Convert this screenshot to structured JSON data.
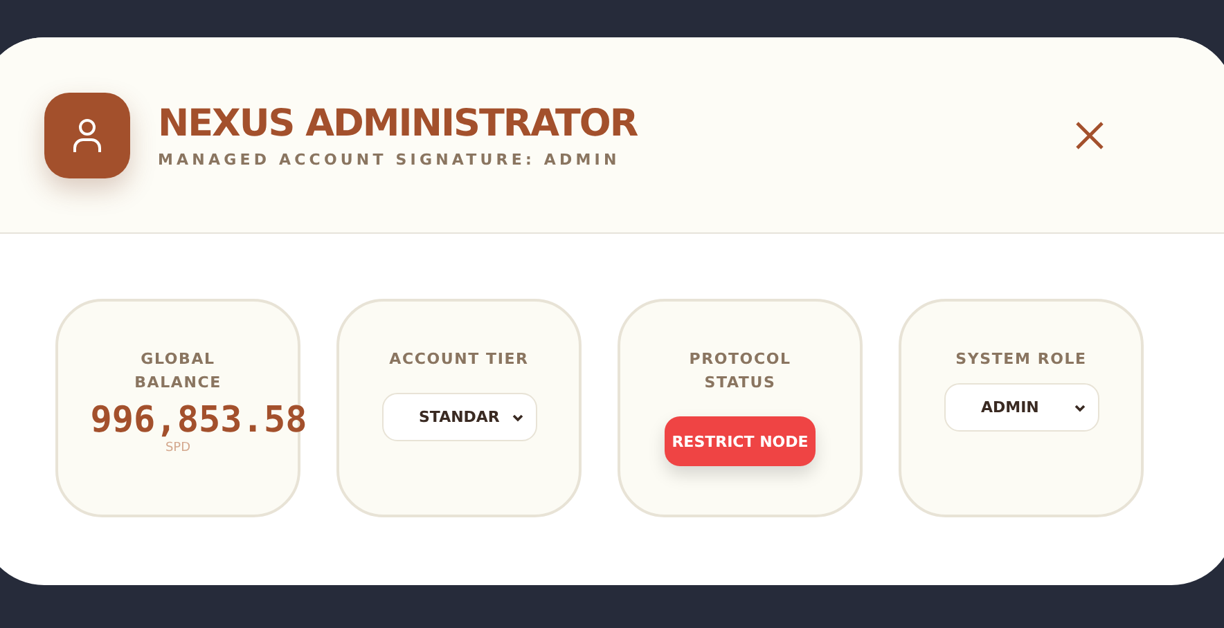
{
  "header": {
    "title": "NEXUS ADMINISTRATOR",
    "subtitle": "MANAGED ACCOUNT SIGNATURE: ADMIN"
  },
  "cards": [
    {
      "kind": "balance",
      "label": "GLOBAL BALANCE",
      "value": "996,853.58",
      "unit": "SPD"
    },
    {
      "kind": "select",
      "label": "ACCOUNT TIER",
      "value": "STANDAR"
    },
    {
      "kind": "action",
      "label": "PROTOCOL STATUS",
      "button": "RESTRICT NODE"
    },
    {
      "kind": "select",
      "label": "SYSTEM ROLE",
      "value": "ADMIN"
    }
  ]
}
